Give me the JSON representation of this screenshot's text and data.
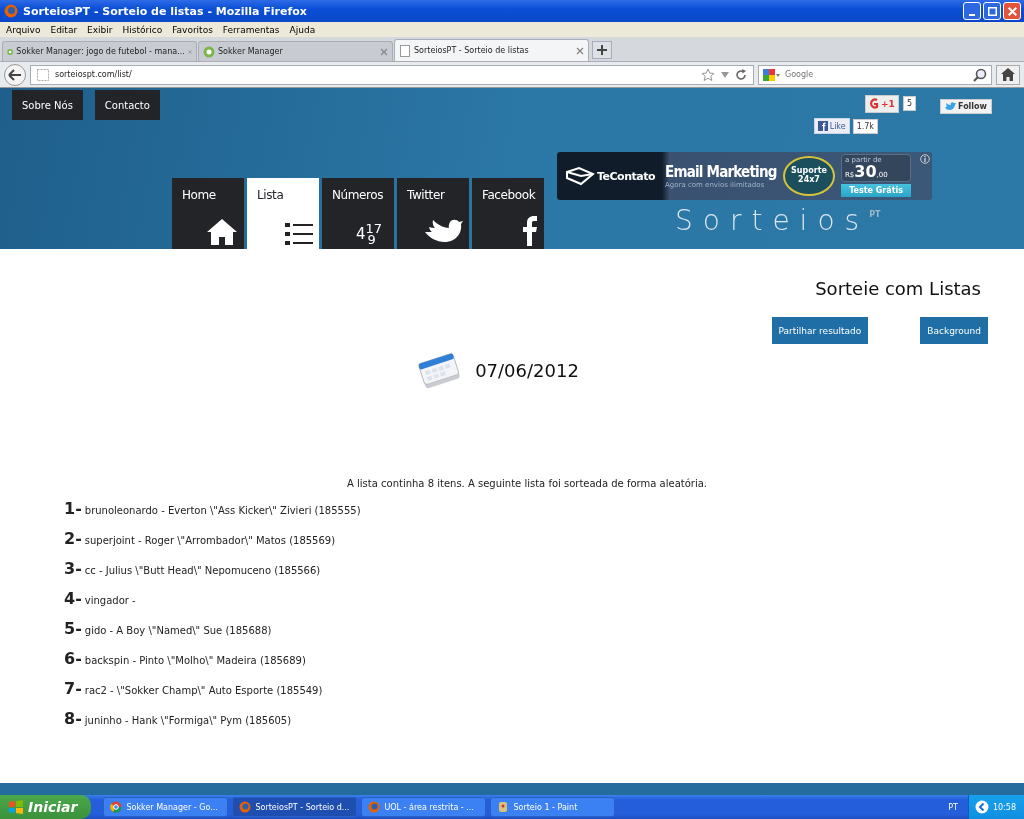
{
  "window": {
    "title": "SorteiosPT - Sorteio de listas - Mozilla Firefox"
  },
  "menu": [
    "Arquivo",
    "Editar",
    "Exibir",
    "Histórico",
    "Favoritos",
    "Ferramentas",
    "Ajuda"
  ],
  "browser_tabs": [
    {
      "title": "Sokker Manager: jogo de futebol - mana...",
      "selected": false
    },
    {
      "title": "Sokker Manager",
      "selected": false
    },
    {
      "title": "SorteiosPT - Sorteio de listas",
      "selected": true
    }
  ],
  "address": {
    "url": "sorteiospt.com/list/"
  },
  "search": {
    "placeholder": "Google"
  },
  "site": {
    "top_links": [
      "Sobre Nós",
      "Contacto"
    ],
    "social": {
      "gplus": "+1",
      "gplus_count": "5",
      "follow": "Follow",
      "like": "Like",
      "like_count": "1.7k"
    },
    "nav": [
      {
        "label": "Home",
        "kind": "home",
        "selected": false
      },
      {
        "label": "Lista",
        "kind": "list",
        "selected": true
      },
      {
        "label": "Números",
        "kind": "numbers",
        "digits": [
          "4",
          "17",
          "9"
        ],
        "selected": false
      },
      {
        "label": "Twitter",
        "kind": "bird",
        "selected": false
      },
      {
        "label": "Facebook",
        "kind": "facebook",
        "selected": false
      }
    ],
    "ad": {
      "brand": "TeContato",
      "headline": "Email Marketing",
      "subline": "Agora com envios ilimitados",
      "badge": "Suporte 24x7",
      "price_note": "a partir de",
      "currency": "R$",
      "price": "30",
      "cents": ",00",
      "cta": "Teste Grátis"
    },
    "logo": {
      "name": "Sorteios",
      "suffix": "PT"
    }
  },
  "content": {
    "heading": "Sorteie com Listas",
    "buttons": [
      "Partilhar resultado",
      "Background"
    ],
    "date": "07/06/2012",
    "summary": "A lista continha 8 itens. A seguinte lista foi sorteada de forma aleatória.",
    "results": [
      {
        "number": "1-",
        "text": "brunoleonardo - Everton \\\"Ass Kicker\\\" Zivieri (185555)"
      },
      {
        "number": "2-",
        "text": "superjoint - Roger \\\"Arrombador\\\" Matos (185569)"
      },
      {
        "number": "3-",
        "text": "cc - Julius \\\"Butt Head\\\" Nepomuceno (185566)"
      },
      {
        "number": "4-",
        "text": "vingador -"
      },
      {
        "number": "5-",
        "text": "gido - A Boy \\\"Named\\\" Sue (185688)"
      },
      {
        "number": "6-",
        "text": "backspin - Pinto \\\"Molho\\\" Madeira (185689)"
      },
      {
        "number": "7-",
        "text": "rac2 - \\\"Sokker Champ\\\" Auto Esporte (185549)"
      },
      {
        "number": "8-",
        "text": "juninho - Hank \\\"Formiga\\\" Pym (185605)"
      }
    ]
  },
  "taskbar": {
    "start": "Iniciar",
    "tasks": [
      {
        "title": "Sokker Manager - Go...",
        "kind": "chrome",
        "selected": false
      },
      {
        "title": "SorteiosPT - Sorteio d...",
        "kind": "firefox",
        "selected": true
      },
      {
        "title": "UOL - área restrita - ...",
        "kind": "firefox",
        "selected": false
      },
      {
        "title": "Sorteio 1 - Paint",
        "kind": "paint",
        "selected": false
      }
    ],
    "language": "PT",
    "clock": "10:58"
  }
}
